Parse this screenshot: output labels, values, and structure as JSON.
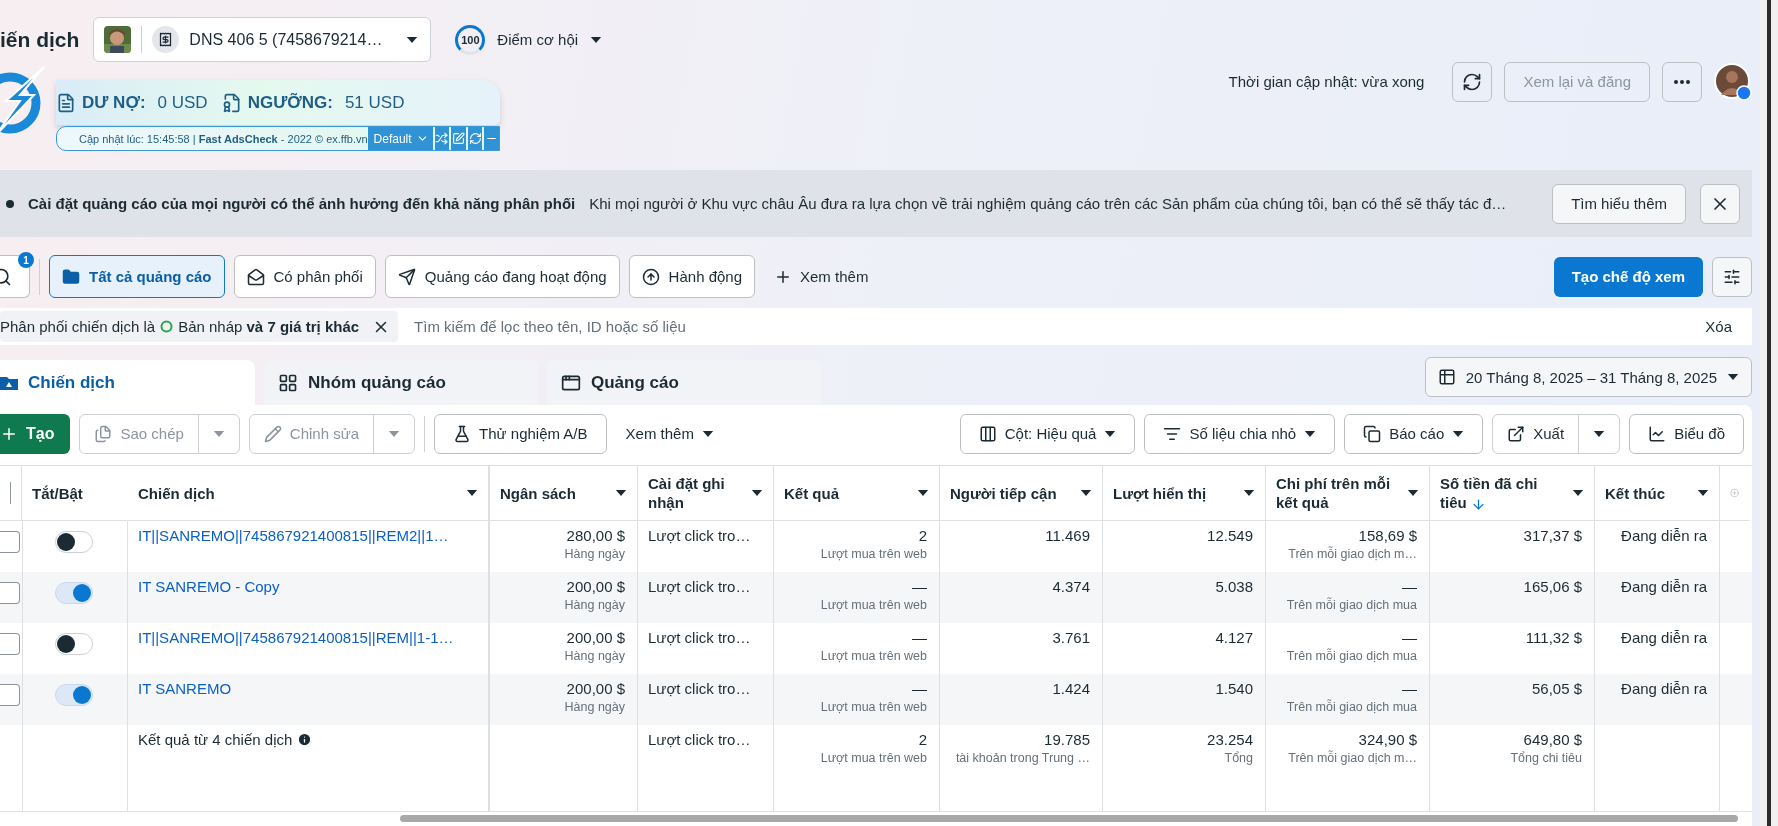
{
  "header": {
    "title": "iến dịch",
    "account": "DNS 406 5 (7458679214…",
    "score": "100",
    "score_label": "Điểm cơ hội",
    "update_time": "Thời gian cập nhật: vừa xong",
    "review_button": "Xem lại và đăng"
  },
  "extension": {
    "debt_label": "DƯ NỢ:",
    "debt_value": "0 USD",
    "threshold_label": "NGƯỠNG:",
    "threshold_value": "51 USD",
    "updated": "Cập nhật lúc: 15:45:58 | **Fast AdsCheck** - 2022 © ex.ffb.vn",
    "preset": "Default"
  },
  "banner": {
    "title": "Cài đặt quảng cáo của mọi người có thể ảnh hưởng đến khả năng phân phối",
    "text": "Khi mọi người ở Khu vực châu Âu đưa ra lựa chọn về trải nghiệm quảng cáo trên các Sản phẩm của chúng tôi, bạn có thể sẽ thấy tác đ…",
    "button": "Tìm hiểu thêm"
  },
  "filters": {
    "search_badge": "1",
    "items": [
      {
        "label": "Tất cả quảng cáo",
        "selected": true
      },
      {
        "label": "Có phân phối",
        "selected": false
      },
      {
        "label": "Quảng cáo đang hoạt động",
        "selected": false
      },
      {
        "label": "Hành động",
        "selected": false
      }
    ],
    "more": "Xem thêm",
    "create_view": "Tạo chế độ xem"
  },
  "filter_bar": {
    "chip_prefix": "Phân phối chiến dịch là",
    "chip_value": "Bản nháp **và 7 giá trị khác**",
    "placeholder": "Tìm kiếm để lọc theo tên, ID hoặc số liệu",
    "clear": "Xóa"
  },
  "level_tabs": [
    {
      "label": "Chiến dịch",
      "selected": true
    },
    {
      "label": "Nhóm quảng cáo",
      "selected": false
    },
    {
      "label": "Quảng cáo",
      "selected": false
    }
  ],
  "date_range": "20 Tháng 8, 2025 – 31 Tháng 8, 2025",
  "toolbar": {
    "create": "Tạo",
    "duplicate": {
      "label": "Sao chép",
      "disabled": true
    },
    "edit": {
      "label": "Chỉnh sửa",
      "disabled": true
    },
    "ab_test": "Thử nghiệm A/B",
    "more": "Xem thêm",
    "columns": "Cột: Hiệu quả",
    "breakdown": "Số liệu chia nhỏ",
    "reports": "Báo cáo",
    "export": "Xuất",
    "charts": "Biểu đồ"
  },
  "table": {
    "select_all_checked": false,
    "columns": [
      {
        "label": "Tắt/Bật",
        "sorted": false
      },
      {
        "label": "Chiến dịch",
        "sorted": false
      },
      {
        "label": "Ngân sách",
        "sorted": false
      },
      {
        "label": "Cài đặt ghi nhận",
        "sorted": false
      },
      {
        "label": "Kết quả",
        "sorted": false
      },
      {
        "label": "Người tiếp cận",
        "sorted": false
      },
      {
        "label": "Lượt hiển thị",
        "sorted": false
      },
      {
        "label": "Chi phí trên mỗi kết quả",
        "sorted": false
      },
      {
        "label": "Số tiền đã chi tiêu",
        "sorted": true
      },
      {
        "label": "Kết thúc",
        "sorted": false
      }
    ],
    "rows": [
      {
        "checked": false,
        "on": false,
        "campaign": "IT||SANREMO||745867921400815||REM2||1…",
        "budget": "280,00 $",
        "budget_type": "Hàng ngày",
        "attribution": "Lượt click tro…",
        "results": "2",
        "results_type": "Lượt mua trên web",
        "reach": "11.469",
        "impressions": "12.549",
        "cost": "158,69 $",
        "cost_type": "Trên mỗi giao dịch m…",
        "spent": "317,37 $",
        "end": "Đang diễn ra"
      },
      {
        "checked": false,
        "on": true,
        "campaign": "IT SANREMO - Copy",
        "budget": "200,00 $",
        "budget_type": "Hàng ngày",
        "attribution": "Lượt click tro…",
        "results": "—",
        "results_type": "Lượt mua trên web",
        "reach": "4.374",
        "impressions": "5.038",
        "cost": "—",
        "cost_type": "Trên mỗi giao dịch mua",
        "spent": "165,06 $",
        "end": "Đang diễn ra"
      },
      {
        "checked": false,
        "on": false,
        "campaign": "IT||SANREMO||745867921400815||REM||1-1…",
        "budget": "200,00 $",
        "budget_type": "Hàng ngày",
        "attribution": "Lượt click tro…",
        "results": "—",
        "results_type": "Lượt mua trên web",
        "reach": "3.761",
        "impressions": "4.127",
        "cost": "—",
        "cost_type": "Trên mỗi giao dịch mua",
        "spent": "111,32 $",
        "end": "Đang diễn ra"
      },
      {
        "checked": false,
        "on": true,
        "campaign": "IT SANREMO",
        "budget": "200,00 $",
        "budget_type": "Hàng ngày",
        "attribution": "Lượt click tro…",
        "results": "—",
        "results_type": "Lượt mua trên web",
        "reach": "1.424",
        "impressions": "1.540",
        "cost": "—",
        "cost_type": "Trên mỗi giao dịch mua",
        "spent": "56,05 $",
        "end": "Đang diễn ra"
      }
    ],
    "summary": {
      "campaign": "Kết quả từ 4 chiến dịch",
      "attribution": "Lượt click tro…",
      "results": "2",
      "results_type": "Lượt mua trên web",
      "reach": "19.785",
      "reach_type": "tài khoản trong Trung …",
      "impressions": "23.254",
      "impressions_type": "Tổng",
      "cost": "324,90 $",
      "cost_type": "Trên mỗi giao dịch m…",
      "spent": "649,80 $",
      "spent_type": "Tổng chi tiêu"
    }
  }
}
